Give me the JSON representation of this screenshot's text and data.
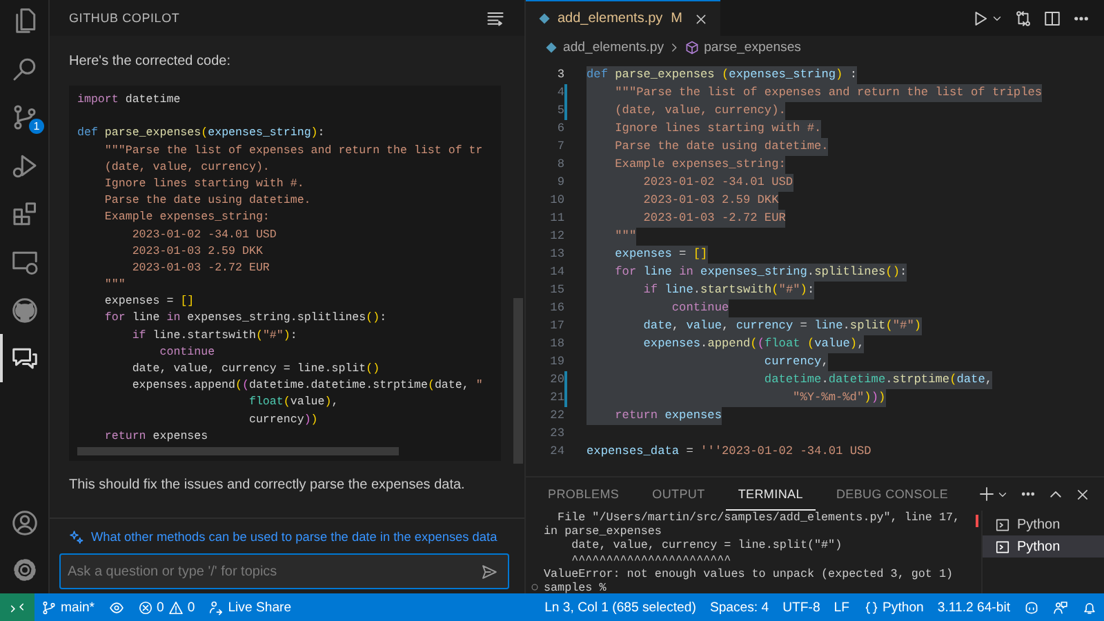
{
  "activity_bar": {
    "items": [
      {
        "kind": "files",
        "selected": false
      },
      {
        "kind": "search",
        "selected": false
      },
      {
        "kind": "source-control",
        "selected": false,
        "badge": "1"
      },
      {
        "kind": "run-debug",
        "selected": false
      },
      {
        "kind": "extensions",
        "selected": false
      },
      {
        "kind": "remote-explorer",
        "selected": false
      },
      {
        "kind": "github",
        "selected": false
      },
      {
        "kind": "chat",
        "selected": true
      }
    ],
    "bottom_items": [
      {
        "kind": "account",
        "selected": false
      },
      {
        "kind": "settings",
        "selected": false
      }
    ]
  },
  "chat": {
    "title": "GITHUB COPILOT",
    "intro": "Here's the corrected code:",
    "code": [
      {
        "kind": "code",
        "tokens": [
          {
            "kind": "kw",
            "text": "import"
          },
          {
            "kind": "pl",
            "text": " datetime"
          }
        ]
      },
      {
        "kind": "blank"
      },
      {
        "kind": "code",
        "tokens": [
          {
            "kind": "def",
            "text": "def"
          },
          {
            "kind": "fn",
            "text": " parse_expenses"
          },
          {
            "kind": "br",
            "text": "("
          },
          {
            "kind": "var",
            "text": "expenses_string"
          },
          {
            "kind": "br",
            "text": ")"
          },
          {
            "kind": "pl",
            "text": ":"
          }
        ]
      },
      {
        "kind": "code",
        "tokens": [
          {
            "kind": "str",
            "text": "    \"\"\"Parse the list of expenses and return the list of tr"
          }
        ]
      },
      {
        "kind": "code",
        "tokens": [
          {
            "kind": "str",
            "text": "    (date, value, currency)."
          }
        ]
      },
      {
        "kind": "code",
        "tokens": [
          {
            "kind": "str",
            "text": "    Ignore lines starting with #."
          }
        ]
      },
      {
        "kind": "code",
        "tokens": [
          {
            "kind": "str",
            "text": "    Parse the date using datetime."
          }
        ]
      },
      {
        "kind": "code",
        "tokens": [
          {
            "kind": "str",
            "text": "    Example expenses_string:"
          }
        ]
      },
      {
        "kind": "code",
        "tokens": [
          {
            "kind": "str",
            "text": "        2023-01-02 -34.01 USD"
          }
        ]
      },
      {
        "kind": "code",
        "tokens": [
          {
            "kind": "str",
            "text": "        2023-01-03 2.59 DKK"
          }
        ]
      },
      {
        "kind": "code",
        "tokens": [
          {
            "kind": "str",
            "text": "        2023-01-03 -2.72 EUR"
          }
        ]
      },
      {
        "kind": "code",
        "tokens": [
          {
            "kind": "str",
            "text": "    \"\"\""
          }
        ]
      },
      {
        "kind": "code",
        "tokens": [
          {
            "kind": "pl",
            "text": "    expenses = "
          },
          {
            "kind": "br",
            "text": "[]"
          }
        ]
      },
      {
        "kind": "code",
        "tokens": [
          {
            "kind": "kw",
            "text": "    for"
          },
          {
            "kind": "pl",
            "text": " line "
          },
          {
            "kind": "kw",
            "text": "in"
          },
          {
            "kind": "pl",
            "text": " expenses_string.splitlines"
          },
          {
            "kind": "br",
            "text": "()"
          },
          {
            "kind": "pl",
            "text": ":"
          }
        ]
      },
      {
        "kind": "code",
        "tokens": [
          {
            "kind": "kw",
            "text": "        if"
          },
          {
            "kind": "pl",
            "text": " line.startswith"
          },
          {
            "kind": "br",
            "text": "("
          },
          {
            "kind": "str",
            "text": "\"#\""
          },
          {
            "kind": "br",
            "text": ")"
          },
          {
            "kind": "pl",
            "text": ":"
          }
        ]
      },
      {
        "kind": "code",
        "tokens": [
          {
            "kind": "kw",
            "text": "            continue"
          }
        ]
      },
      {
        "kind": "code",
        "tokens": [
          {
            "kind": "pl",
            "text": "        date, value, currency = line.split"
          },
          {
            "kind": "br",
            "text": "()"
          }
        ]
      },
      {
        "kind": "code",
        "tokens": [
          {
            "kind": "pl",
            "text": "        expenses.append"
          },
          {
            "kind": "br",
            "text": "("
          },
          {
            "kind": "br2",
            "text": "("
          },
          {
            "kind": "pl",
            "text": "datetime.datetime.strptime"
          },
          {
            "kind": "br",
            "text": "("
          },
          {
            "kind": "pl",
            "text": "date, "
          },
          {
            "kind": "str",
            "text": "\""
          }
        ]
      },
      {
        "kind": "code",
        "tokens": [
          {
            "kind": "ty",
            "text": "                         float"
          },
          {
            "kind": "br",
            "text": "("
          },
          {
            "kind": "pl",
            "text": "value"
          },
          {
            "kind": "br",
            "text": ")"
          },
          {
            "kind": "pl",
            "text": ","
          }
        ]
      },
      {
        "kind": "code",
        "tokens": [
          {
            "kind": "pl",
            "text": "                         currency"
          },
          {
            "kind": "br2",
            "text": ")"
          },
          {
            "kind": "br",
            "text": ")"
          }
        ]
      },
      {
        "kind": "code",
        "tokens": [
          {
            "kind": "kw",
            "text": "    return"
          },
          {
            "kind": "pl",
            "text": " expenses"
          }
        ]
      }
    ],
    "outro": "This should fix the issues and correctly parse the expenses data.",
    "suggestion": "What other methods can be used to parse the date in the expenses data",
    "input": {
      "placeholder": "Ask a question or type '/' for topics"
    }
  },
  "editor": {
    "tab": {
      "label": "add_elements.py",
      "status": "M",
      "selected": true
    },
    "breadcrumb": [
      {
        "kind": "file",
        "label": "add_elements.py"
      },
      {
        "kind": "function",
        "label": "parse_expenses"
      }
    ],
    "lines": [
      {
        "number": "3",
        "selected": true,
        "modified": false,
        "tokens": [
          {
            "kind": "def",
            "text": "def"
          },
          {
            "kind": "fn",
            "text": " parse_expenses"
          },
          {
            "kind": "br",
            "text": " ("
          },
          {
            "kind": "var",
            "text": "expenses_string"
          },
          {
            "kind": "br",
            "text": ")"
          },
          {
            "kind": "pl",
            "text": " :"
          }
        ]
      },
      {
        "number": "4",
        "selected": true,
        "modified": true,
        "tokens": [
          {
            "kind": "str",
            "text": "    \"\"\"Parse the list of expenses and return the list of triples"
          }
        ]
      },
      {
        "number": "5",
        "selected": true,
        "modified": true,
        "tokens": [
          {
            "kind": "str",
            "text": "    (date, value, currency)."
          }
        ]
      },
      {
        "number": "6",
        "selected": true,
        "modified": false,
        "tokens": [
          {
            "kind": "str",
            "text": "    Ignore lines starting with #."
          }
        ]
      },
      {
        "number": "7",
        "selected": true,
        "modified": false,
        "tokens": [
          {
            "kind": "str",
            "text": "    Parse the date using datetime."
          }
        ]
      },
      {
        "number": "8",
        "selected": true,
        "modified": false,
        "tokens": [
          {
            "kind": "str",
            "text": "    Example expenses_string:"
          }
        ]
      },
      {
        "number": "9",
        "selected": true,
        "modified": false,
        "tokens": [
          {
            "kind": "str",
            "text": "        2023-01-02 -34.01 USD"
          }
        ]
      },
      {
        "number": "10",
        "selected": true,
        "modified": false,
        "tokens": [
          {
            "kind": "str",
            "text": "        2023-01-03 2.59 DKK"
          }
        ]
      },
      {
        "number": "11",
        "selected": true,
        "modified": false,
        "tokens": [
          {
            "kind": "str",
            "text": "        2023-01-03 -2.72 EUR"
          }
        ]
      },
      {
        "number": "12",
        "selected": true,
        "modified": false,
        "tokens": [
          {
            "kind": "str",
            "text": "    \"\"\""
          }
        ]
      },
      {
        "number": "13",
        "selected": true,
        "modified": false,
        "tokens": [
          {
            "kind": "var",
            "text": "    expenses"
          },
          {
            "kind": "pl",
            "text": " = "
          },
          {
            "kind": "br",
            "text": "[]"
          }
        ]
      },
      {
        "number": "14",
        "selected": true,
        "modified": false,
        "tokens": [
          {
            "kind": "kw",
            "text": "    for"
          },
          {
            "kind": "var",
            "text": " line"
          },
          {
            "kind": "kw",
            "text": " in"
          },
          {
            "kind": "var",
            "text": " expenses_string"
          },
          {
            "kind": "pl",
            "text": "."
          },
          {
            "kind": "fn",
            "text": "splitlines"
          },
          {
            "kind": "br",
            "text": "()"
          },
          {
            "kind": "pl",
            "text": ":"
          }
        ]
      },
      {
        "number": "15",
        "selected": true,
        "modified": false,
        "tokens": [
          {
            "kind": "kw",
            "text": "        if"
          },
          {
            "kind": "var",
            "text": " line"
          },
          {
            "kind": "pl",
            "text": "."
          },
          {
            "kind": "fn",
            "text": "startswith"
          },
          {
            "kind": "br",
            "text": "("
          },
          {
            "kind": "str",
            "text": "\"#\""
          },
          {
            "kind": "br",
            "text": ")"
          },
          {
            "kind": "pl",
            "text": ":"
          }
        ]
      },
      {
        "number": "16",
        "selected": true,
        "modified": false,
        "tokens": [
          {
            "kind": "kw",
            "text": "            continue"
          }
        ]
      },
      {
        "number": "17",
        "selected": true,
        "modified": false,
        "tokens": [
          {
            "kind": "var",
            "text": "        date"
          },
          {
            "kind": "pl",
            "text": ", "
          },
          {
            "kind": "var",
            "text": "value"
          },
          {
            "kind": "pl",
            "text": ", "
          },
          {
            "kind": "var",
            "text": "currency"
          },
          {
            "kind": "pl",
            "text": " = "
          },
          {
            "kind": "var",
            "text": "line"
          },
          {
            "kind": "pl",
            "text": "."
          },
          {
            "kind": "fn",
            "text": "split"
          },
          {
            "kind": "br",
            "text": "("
          },
          {
            "kind": "str",
            "text": "\"#\""
          },
          {
            "kind": "br",
            "text": ")"
          }
        ]
      },
      {
        "number": "18",
        "selected": true,
        "modified": false,
        "tokens": [
          {
            "kind": "var",
            "text": "        expenses"
          },
          {
            "kind": "pl",
            "text": "."
          },
          {
            "kind": "fn",
            "text": "append"
          },
          {
            "kind": "br",
            "text": "("
          },
          {
            "kind": "br2",
            "text": "("
          },
          {
            "kind": "ty",
            "text": "float"
          },
          {
            "kind": "br",
            "text": " ("
          },
          {
            "kind": "var",
            "text": "value"
          },
          {
            "kind": "br",
            "text": ")"
          },
          {
            "kind": "pl",
            "text": ","
          }
        ]
      },
      {
        "number": "19",
        "selected": true,
        "modified": false,
        "tokens": [
          {
            "kind": "var",
            "text": "                         currency"
          },
          {
            "kind": "pl",
            "text": ","
          }
        ]
      },
      {
        "number": "20",
        "selected": true,
        "modified": true,
        "tokens": [
          {
            "kind": "ty",
            "text": "                         datetime"
          },
          {
            "kind": "pl",
            "text": "."
          },
          {
            "kind": "ty",
            "text": "datetime"
          },
          {
            "kind": "pl",
            "text": "."
          },
          {
            "kind": "fn",
            "text": "strptime"
          },
          {
            "kind": "br",
            "text": "("
          },
          {
            "kind": "var",
            "text": "date"
          },
          {
            "kind": "pl",
            "text": ","
          }
        ]
      },
      {
        "number": "21",
        "selected": true,
        "modified": true,
        "tokens": [
          {
            "kind": "str",
            "text": "                             \"%Y-%m-%d\""
          },
          {
            "kind": "br",
            "text": ")"
          },
          {
            "kind": "br2",
            "text": ")"
          },
          {
            "kind": "br",
            "text": ")"
          }
        ]
      },
      {
        "number": "22",
        "selected": true,
        "modified": false,
        "tokens": [
          {
            "kind": "kw",
            "text": "    return"
          },
          {
            "kind": "var",
            "text": " expenses"
          }
        ]
      },
      {
        "number": "23",
        "selected": false,
        "modified": false
      },
      {
        "number": "24",
        "selected": false,
        "modified": false,
        "tokens": [
          {
            "kind": "var",
            "text": "expenses_data"
          },
          {
            "kind": "pl",
            "text": " = "
          },
          {
            "kind": "str",
            "text": "'''2023-01-02 -34.01 USD"
          }
        ]
      }
    ]
  },
  "panel": {
    "tabs": [
      {
        "label": "PROBLEMS",
        "selected": false
      },
      {
        "label": "OUTPUT",
        "selected": false
      },
      {
        "label": "TERMINAL",
        "selected": true
      },
      {
        "label": "DEBUG CONSOLE",
        "selected": false
      }
    ],
    "terminal_lines": [
      "  File \"/Users/martin/src/samples/add_elements.py\", line 17,",
      "in parse_expenses",
      "    date, value, currency = line.split(\"#\")",
      "    ^^^^^^^^^^^^^^^^^^^^^^^",
      "ValueError: not enough values to unpack (expected 3, got 1)",
      "samples %"
    ],
    "terminals": [
      {
        "label": "Python",
        "selected": false
      },
      {
        "label": "Python",
        "selected": true
      }
    ]
  },
  "status_bar": {
    "branch": "main*",
    "errors": "0",
    "warnings": "0",
    "live_share": "Live Share",
    "cursor": "Ln 3, Col 1 (685 selected)",
    "indentation": "Spaces: 4",
    "encoding": "UTF-8",
    "eol": "LF",
    "language": "Python",
    "interpreter": "3.11.2 64-bit"
  }
}
